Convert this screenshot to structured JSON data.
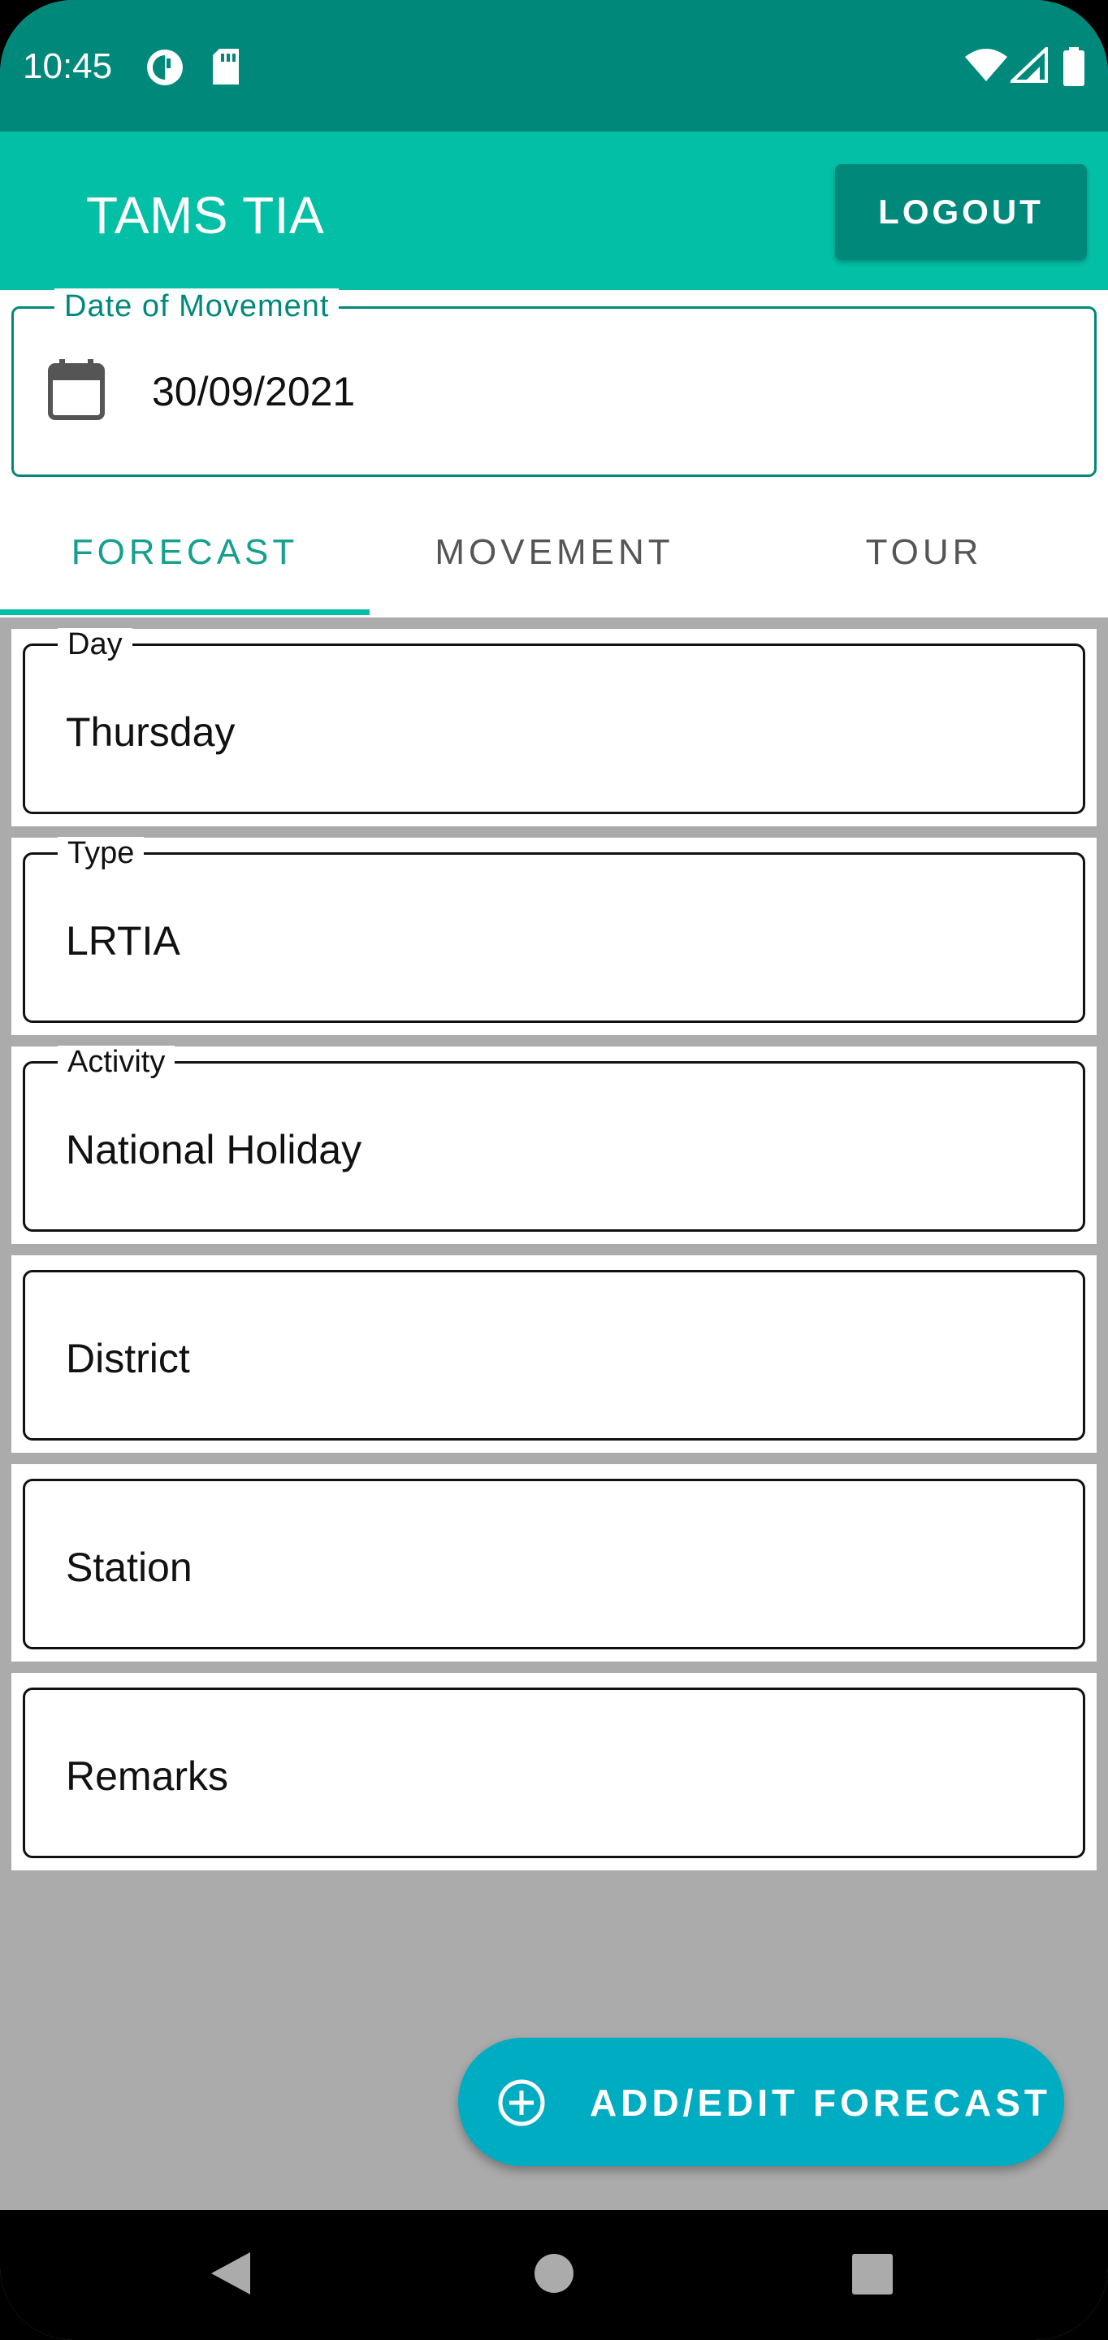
{
  "status_bar": {
    "time": "10:45",
    "left_icons": [
      "data-saver-icon",
      "sd-card-icon"
    ],
    "right_icons": [
      "wifi-icon",
      "cell-signal-icon",
      "battery-icon"
    ]
  },
  "app_bar": {
    "title": "TAMS TIA",
    "logout_label": "LOGOUT"
  },
  "date_field": {
    "label": "Date of Movement",
    "value": "30/09/2021",
    "icon": "calendar-icon"
  },
  "tabs": [
    {
      "label": "FORECAST",
      "active": true
    },
    {
      "label": "MOVEMENT",
      "active": false
    },
    {
      "label": "TOUR",
      "active": false
    }
  ],
  "fields": [
    {
      "label": "Day",
      "value": "Thursday"
    },
    {
      "label": "Type",
      "value": "LRTIA"
    },
    {
      "label": "Activity",
      "value": "National Holiday"
    },
    {
      "label": "",
      "value": "District"
    },
    {
      "label": "",
      "value": "Station"
    },
    {
      "label": "",
      "value": "Remarks"
    }
  ],
  "fab": {
    "label": "ADD/EDIT FORECAST",
    "icon": "add-circle-icon"
  },
  "nav_bar": {
    "buttons": [
      "back-icon",
      "home-icon",
      "recents-icon"
    ]
  },
  "colors": {
    "status_bar": "#00897b",
    "app_bar": "#03bfa5",
    "accent": "#00897b",
    "fab": "#00acc1"
  }
}
